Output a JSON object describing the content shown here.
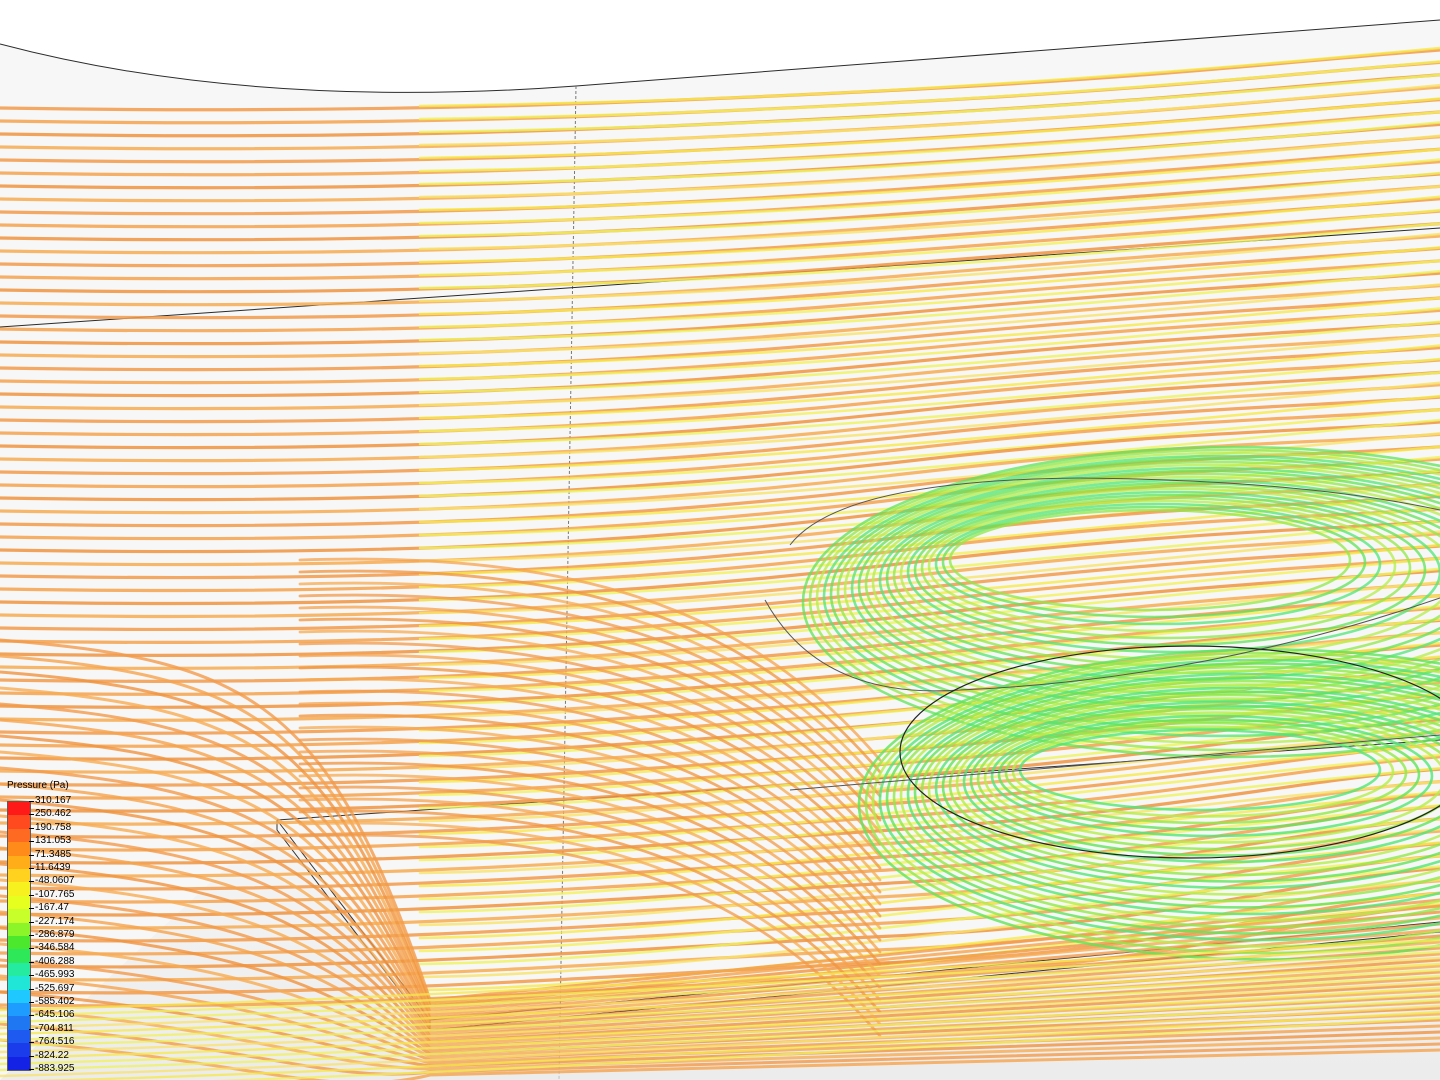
{
  "legend": {
    "title": "Pressure (Pa)",
    "values": [
      "310.167",
      "250.462",
      "190.758",
      "131.053",
      "71.3485",
      "11.6439",
      "-48.0607",
      "-107.765",
      "-167.47",
      "-227.174",
      "-286.879",
      "-346.584",
      "-406.288",
      "-465.993",
      "-525.697",
      "-585.402",
      "-645.106",
      "-704.811",
      "-764.516",
      "-824.22",
      "-883.925"
    ],
    "colors": [
      "#ff1a1a",
      "#ff4a1f",
      "#ff6a22",
      "#ff8c1a",
      "#ffae1a",
      "#ffd21f",
      "#f7f21f",
      "#e6ff1f",
      "#c8ff2a",
      "#8cf52a",
      "#4ce82e",
      "#2ee85a",
      "#24eba0",
      "#1fe6d6",
      "#1fc8ff",
      "#1f9cff",
      "#1f78f2",
      "#1f5af0",
      "#1a3ceb",
      "#1422e6"
    ]
  }
}
